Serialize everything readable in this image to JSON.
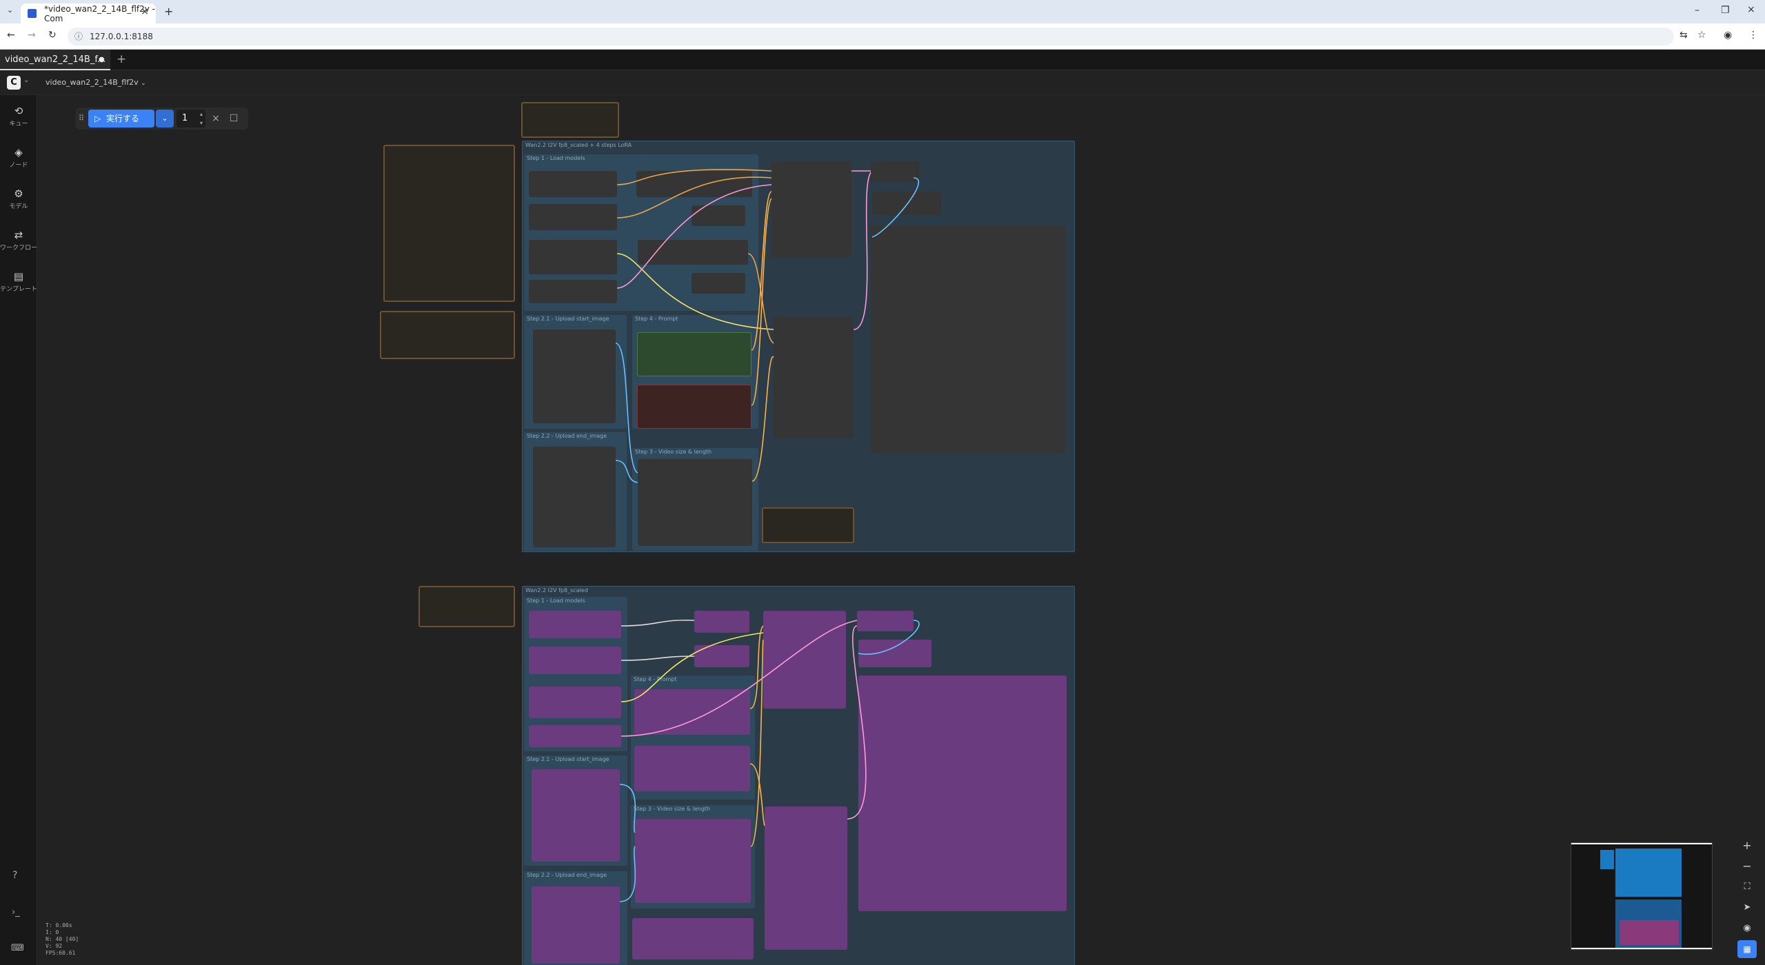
{
  "browser": {
    "tab_title": "*video_wan2_2_14B_flf2v - Com",
    "url": "127.0.0.1:8188",
    "new_tab_symbol": "+"
  },
  "app": {
    "workflow_tab": "video_wan2_2_14B_f...",
    "workflow_name": "video_wan2_2_14B_flf2v",
    "add_tab_symbol": "+"
  },
  "sidebar": {
    "items": [
      {
        "label": "キュー",
        "icon": "history-icon"
      },
      {
        "label": "ノード",
        "icon": "node-icon"
      },
      {
        "label": "モデル",
        "icon": "model-icon"
      },
      {
        "label": "ワークフロー",
        "icon": "workflow-icon"
      },
      {
        "label": "テンプレート",
        "icon": "template-icon"
      }
    ]
  },
  "runbar": {
    "run_label": "実行する",
    "count": "1"
  },
  "stats": {
    "t": "T: 0.00s",
    "i": "I: 0",
    "n": "N: 40 [40]",
    "v": "V: 92",
    "fps": "FPS:60.61"
  },
  "groups": {
    "top": "Wan2.2 I2V fp8_scaled + 4 steps LoRA",
    "top_step1": "Step 1 - Load models",
    "top_step21": "Step 2.1 - Upload start_image",
    "top_step22": "Step 2.2 - Upload end_image",
    "top_step4": "Step 4 - Prompt",
    "top_step3": "Step 3 - Video size & length",
    "bottom": "Wan2.2 I2V fp8_scaled",
    "bot_step1": "Step 1 - Load models",
    "bot_step4": "Step 4 - Prompt",
    "bot_step21": "Step 2.1 - Upload start_image",
    "bot_step3": "Step 3 - Video size & length",
    "bot_step22": "Step 2.2 - Upload end_image"
  },
  "colors": {
    "accent": "#3b82f6",
    "group_blue": "#2f4a5c",
    "node_purple": "#6b3b80",
    "note_brown": "#6b5230"
  }
}
